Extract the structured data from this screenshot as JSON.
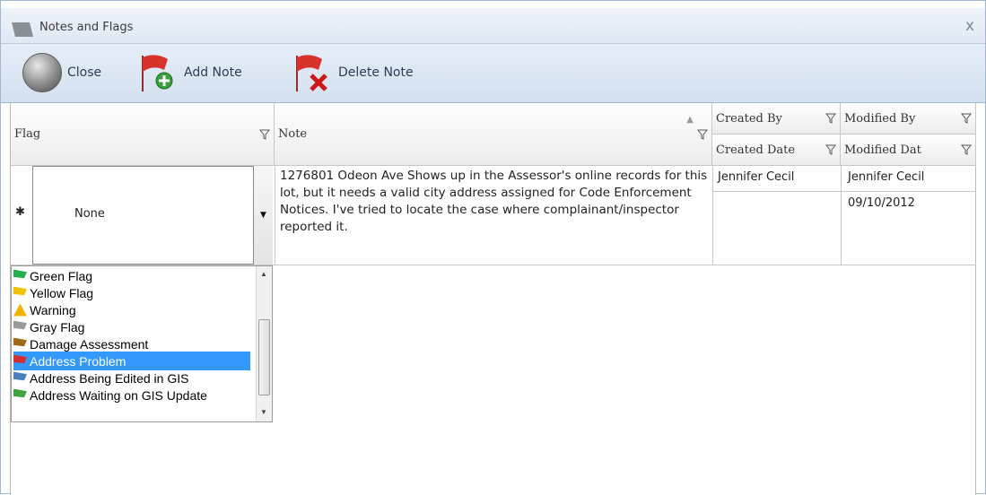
{
  "window": {
    "title": "Notes and Flags",
    "close_glyph": "x"
  },
  "toolbar": {
    "close_label": "Close",
    "add_note_label": "Add Note",
    "delete_note_label": "Delete Note"
  },
  "columns": {
    "flag": "Flag",
    "note": "Note",
    "created_by": "Created By",
    "created_date": "Created Date",
    "modified_by": "Modified By",
    "modified_date": "Modified Dat"
  },
  "row": {
    "indicator": "✱",
    "flag_value": "None",
    "note": "1276801 Odeon Ave Shows up in the Assessor's online records for this lot, but it needs a valid city address assigned for Code Enforcement Notices. I've tried to locate the case where complainant/inspector reported it.",
    "created_by": "Jennifer Cecil",
    "modified_by": "Jennifer Cecil",
    "modified_date": "09/10/2012"
  },
  "flag_options": [
    {
      "label": "Green Flag",
      "icon": "green-flag-icon",
      "color": "#22b14c"
    },
    {
      "label": "Yellow Flag",
      "icon": "yellow-flag-icon",
      "color": "#f2c200"
    },
    {
      "label": "Warning",
      "icon": "warning-icon",
      "color": "#f0b400"
    },
    {
      "label": "Gray Flag",
      "icon": "gray-flag-icon",
      "color": "#9a9a9a"
    },
    {
      "label": "Damage Assessment",
      "icon": "damage-assessment-icon",
      "color": "#a06a1c"
    },
    {
      "label": "Address Problem",
      "icon": "address-problem-icon",
      "color": "#d32f2f",
      "selected": true
    },
    {
      "label": "Address Being Edited in GIS",
      "icon": "address-editing-icon",
      "color": "#4a7fc1"
    },
    {
      "label": "Address Waiting on GIS Update",
      "icon": "address-waiting-icon",
      "color": "#3fa33f"
    }
  ],
  "colors": {
    "accent": "#3399ff",
    "title_bar": "#dfe8f3",
    "toolbar": "#d3e0ef"
  }
}
